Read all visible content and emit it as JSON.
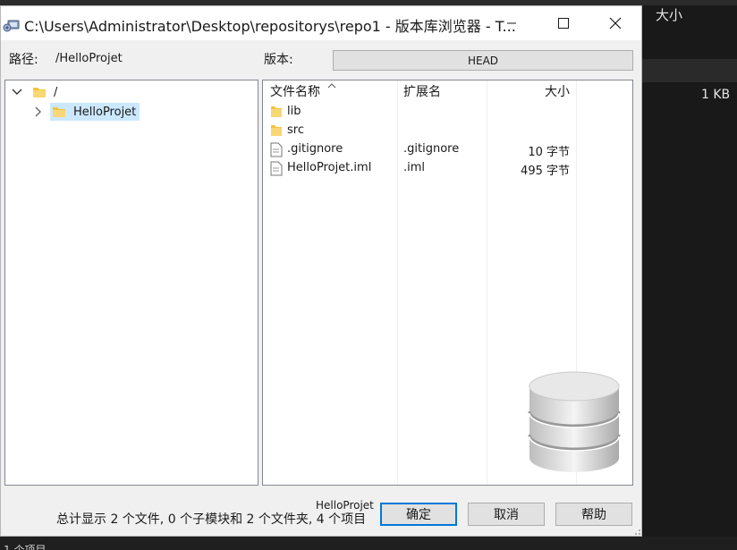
{
  "background": {
    "column_header": "大小",
    "size_value": "1 KB",
    "status_text": "1 个项目"
  },
  "dialog": {
    "title": "C:\\Users\\Administrator\\Desktop\\repositorys\\repo1 - 版本库浏览器 - T...",
    "path_label": "路径:",
    "path_value": "/HelloProjet",
    "version_label": "版本:",
    "version_value": "HEAD",
    "tree": {
      "root": "/",
      "child": "HelloProjet"
    },
    "columns": {
      "name": "文件名称",
      "ext": "扩展名",
      "size": "大小"
    },
    "files": [
      {
        "name": "lib",
        "ext": "",
        "size": "",
        "icon": "folder-icon"
      },
      {
        "name": "src",
        "ext": "",
        "size": "",
        "icon": "folder-icon"
      },
      {
        "name": ".gitignore",
        "ext": ".gitignore",
        "size": "10 字节",
        "icon": "file-icon"
      },
      {
        "name": "HelloProjet.iml",
        "ext": ".iml",
        "size": "495 字节",
        "icon": "file-icon"
      }
    ],
    "footer_name": "HelloProjet",
    "summary": "总计显示 2 个文件, 0 个子模块和 2 个文件夹, 4 个项目",
    "buttons": {
      "ok": "确定",
      "cancel": "取消",
      "help": "帮助"
    }
  },
  "colors": {
    "folder": "#f2c43d",
    "selection": "#cce8ff",
    "accent": "#0078d7"
  }
}
